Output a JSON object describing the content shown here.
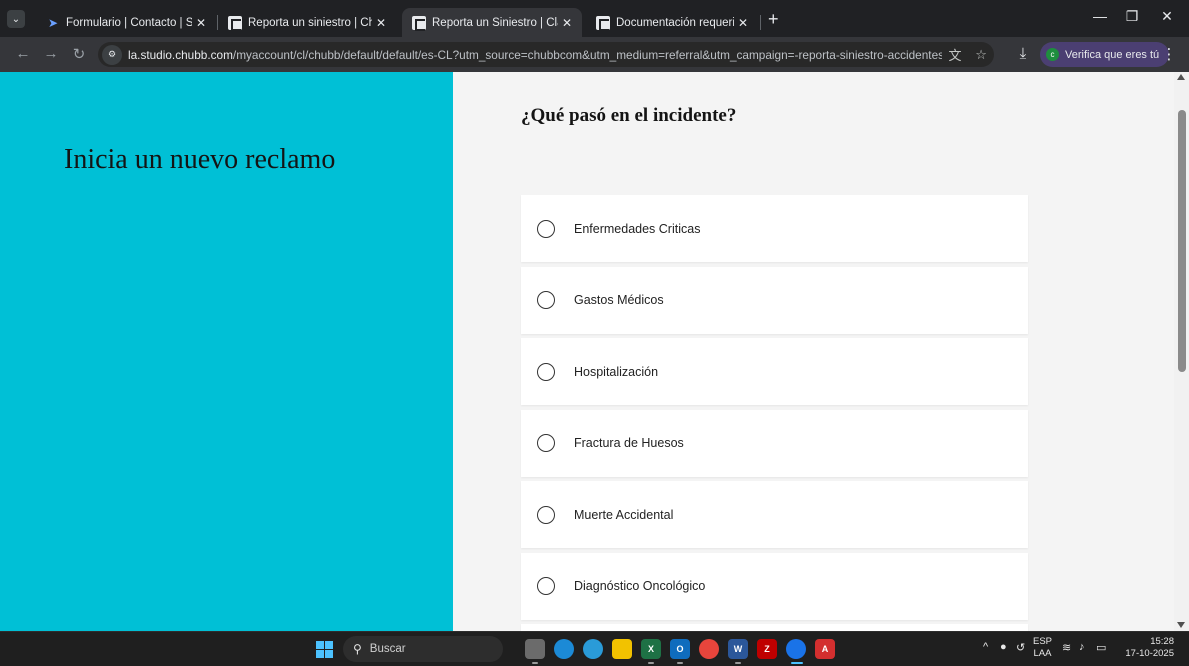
{
  "browser": {
    "tabs": [
      {
        "title": "Formulario | Contacto | Seguro",
        "favicon": "bird-icon",
        "active": false
      },
      {
        "title": "Reporta un siniestro | Chubb",
        "favicon": "chubb-c-icon",
        "active": false
      },
      {
        "title": "Reporta un Siniestro | Claims",
        "favicon": "chubb-c-icon",
        "active": true
      },
      {
        "title": "Documentación requerida para",
        "favicon": "chubb-c-icon",
        "active": false
      }
    ],
    "url_host": "la.studio.chubb.com",
    "url_path": "/myaccount/cl/chubb/default/default/es-CL?utm_source=chubbcom&utm_medium=referral&utm_campaign=-reporta-siniestro-accidentes-y-salud-cl",
    "verify_chip_label": "Verifica que eres tú",
    "verify_chip_letter": "c"
  },
  "page": {
    "left_heading": "Inicia un nuevo reclamo",
    "question": "¿Qué pasó en el incidente?",
    "options": [
      {
        "label": "Enfermedades Criticas",
        "selected": false
      },
      {
        "label": "Gastos Médicos",
        "selected": false
      },
      {
        "label": "Hospitalización",
        "selected": false
      },
      {
        "label": "Fractura de Huesos",
        "selected": false
      },
      {
        "label": "Muerte Accidental",
        "selected": false
      },
      {
        "label": "Diagnóstico Oncológico",
        "selected": false
      }
    ],
    "colors": {
      "left_panel": "#00c0d6",
      "background": "#f4f4f4"
    }
  },
  "taskbar": {
    "search_placeholder": "Buscar",
    "lang_line1": "ESP",
    "lang_line2": "LAA",
    "time": "15:28",
    "date": "17-10-2025"
  }
}
